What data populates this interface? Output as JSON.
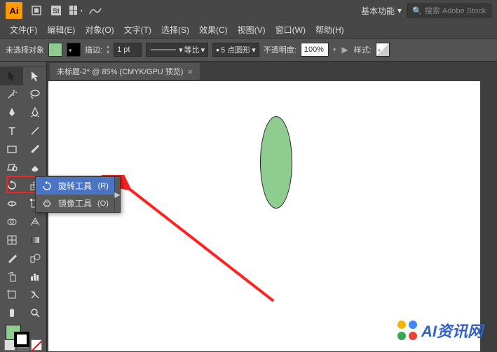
{
  "titlebar": {
    "workspace": "基本功能",
    "search_placeholder": "搜索 Adobe Stock"
  },
  "menu": {
    "file": "文件(F)",
    "edit": "编辑(E)",
    "object": "对象(O)",
    "type": "文字(T)",
    "select": "选择(S)",
    "effect": "效果(C)",
    "view": "视图(V)",
    "window": "窗口(W)",
    "help": "帮助(H)"
  },
  "ctrlbar": {
    "no_selection": "未选择对象",
    "stroke_label": "描边:",
    "stroke_value": "1 pt",
    "uniform": "等比",
    "brush_preset": "5 点圆形",
    "opacity_label": "不透明度:",
    "opacity_value": "100%",
    "style_label": "样式:"
  },
  "tab": {
    "title": "未标题-2* @ 85% (CMYK/GPU 预览)"
  },
  "flyout": {
    "rotate": {
      "name": "旋转工具",
      "short": "(R)"
    },
    "reflect": {
      "name": "镜像工具",
      "short": "(O)"
    }
  },
  "colors": {
    "fill": "#8fcc8f",
    "highlight": "#ff2020",
    "accent": "#ff9a00"
  },
  "watermark": {
    "text": "AI资讯网"
  }
}
